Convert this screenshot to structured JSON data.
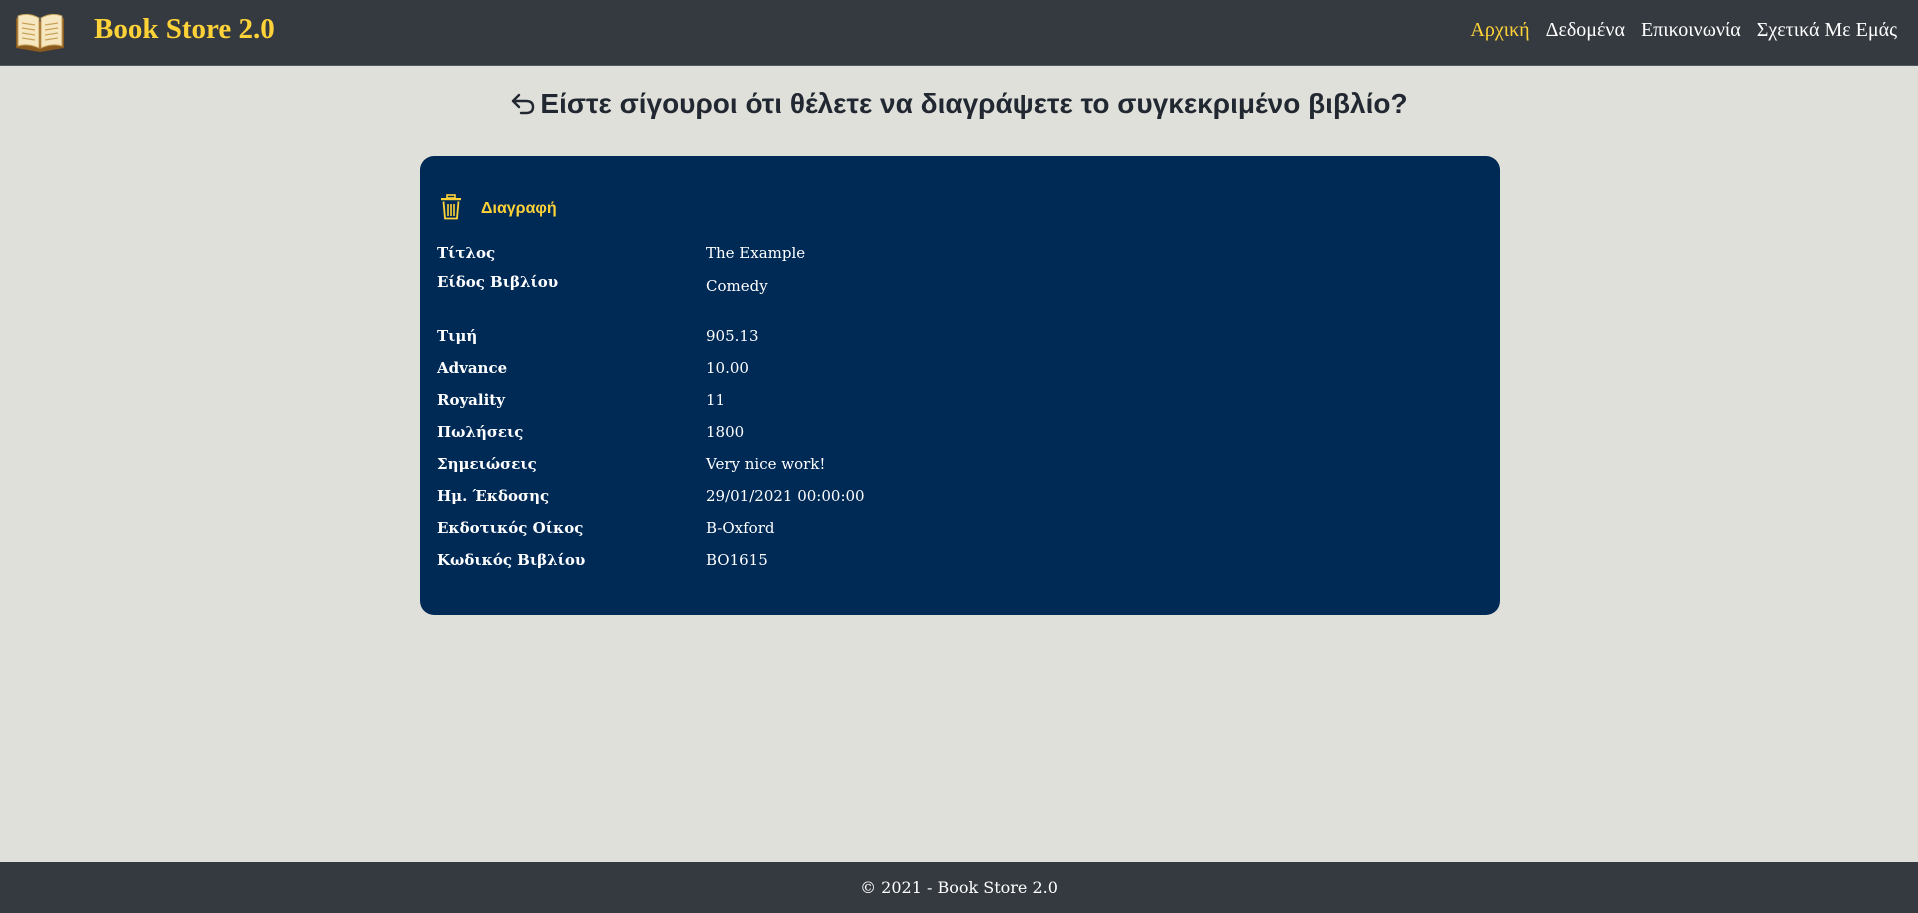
{
  "app": {
    "brand": "Book Store 2.0"
  },
  "nav": {
    "items": [
      {
        "label": "Αρχική",
        "active": true
      },
      {
        "label": "Δεδομένα",
        "active": false
      },
      {
        "label": "Επικοινωνία",
        "active": false
      },
      {
        "label": "Σχετικά Με Εμάς",
        "active": false
      }
    ]
  },
  "page": {
    "heading": "Είστε σίγουροι ότι θέλετε να διαγράψετε το συγκεκριμένο βιβλίο?"
  },
  "card": {
    "delete_label": "Διαγραφή",
    "fields": [
      {
        "label": "Τίτλος",
        "value": "The Example"
      },
      {
        "label": "Είδος Βιβλίου",
        "value": "Comedy"
      },
      {
        "label": "Τιμή",
        "value": "905.13"
      },
      {
        "label": "Advance",
        "value": "10.00"
      },
      {
        "label": "Royality",
        "value": "11"
      },
      {
        "label": "Πωλήσεις",
        "value": "1800"
      },
      {
        "label": "Σημειώσεις",
        "value": "Very nice work!"
      },
      {
        "label": "Ημ. Έκδοσης",
        "value": "29/01/2021 00:00:00"
      },
      {
        "label": "Εκδοτικός Οίκος",
        "value": "B-Oxford"
      },
      {
        "label": "Κωδικός Βιβλίου",
        "value": "BO1615"
      }
    ]
  },
  "footer": {
    "text": "© 2021 - Book Store 2.0"
  },
  "colors": {
    "navbar": "#343a40",
    "accent": "#ffd338",
    "card": "#002a56",
    "page_bg": "#e0e0da"
  },
  "icons": {
    "logo": "open-book-icon",
    "back": "return-arrow-icon",
    "delete": "trash-icon"
  }
}
